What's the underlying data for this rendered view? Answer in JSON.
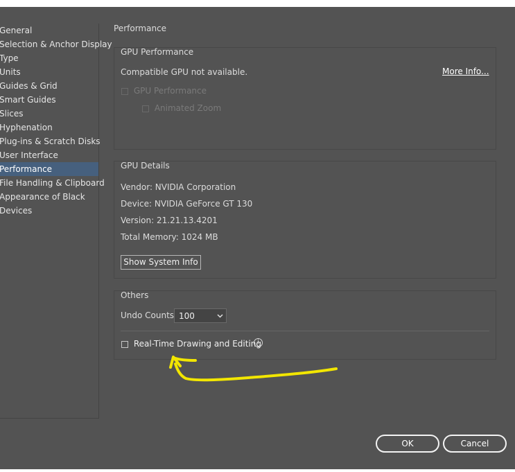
{
  "sidebar": {
    "items": [
      {
        "label": "General"
      },
      {
        "label": "Selection & Anchor Display"
      },
      {
        "label": "Type"
      },
      {
        "label": "Units"
      },
      {
        "label": "Guides & Grid"
      },
      {
        "label": "Smart Guides"
      },
      {
        "label": "Slices"
      },
      {
        "label": "Hyphenation"
      },
      {
        "label": "Plug-ins & Scratch Disks"
      },
      {
        "label": "User Interface"
      },
      {
        "label": "Performance"
      },
      {
        "label": "File Handling & Clipboard"
      },
      {
        "label": "Appearance of Black"
      },
      {
        "label": "Devices"
      }
    ],
    "selected": "Performance"
  },
  "main": {
    "title": "Performance",
    "gpu_performance": {
      "label": "GPU Performance",
      "status_text": "Compatible GPU not available.",
      "more_info_link": "More Info...",
      "gpu_checkbox_label": "GPU Performance",
      "animated_zoom_label": "Animated Zoom"
    },
    "gpu_details": {
      "label": "GPU Details",
      "vendor": "Vendor: NVIDIA Corporation",
      "device": "Device: NVIDIA GeForce GT 130",
      "version": "Version: 21.21.13.4201",
      "memory": "Total Memory: 1024 MB",
      "show_system_info": "Show System Info"
    },
    "others": {
      "label": "Others",
      "undo_label": "Undo Counts:",
      "undo_value": "100",
      "realtime_label": "Real-Time Drawing and Editing",
      "info_icon_glyph": "i"
    }
  },
  "footer": {
    "ok_label": "OK",
    "cancel_label": "Cancel"
  },
  "colors": {
    "background": "#535353",
    "selection": "#46607e",
    "annotation": "#f2e600"
  }
}
